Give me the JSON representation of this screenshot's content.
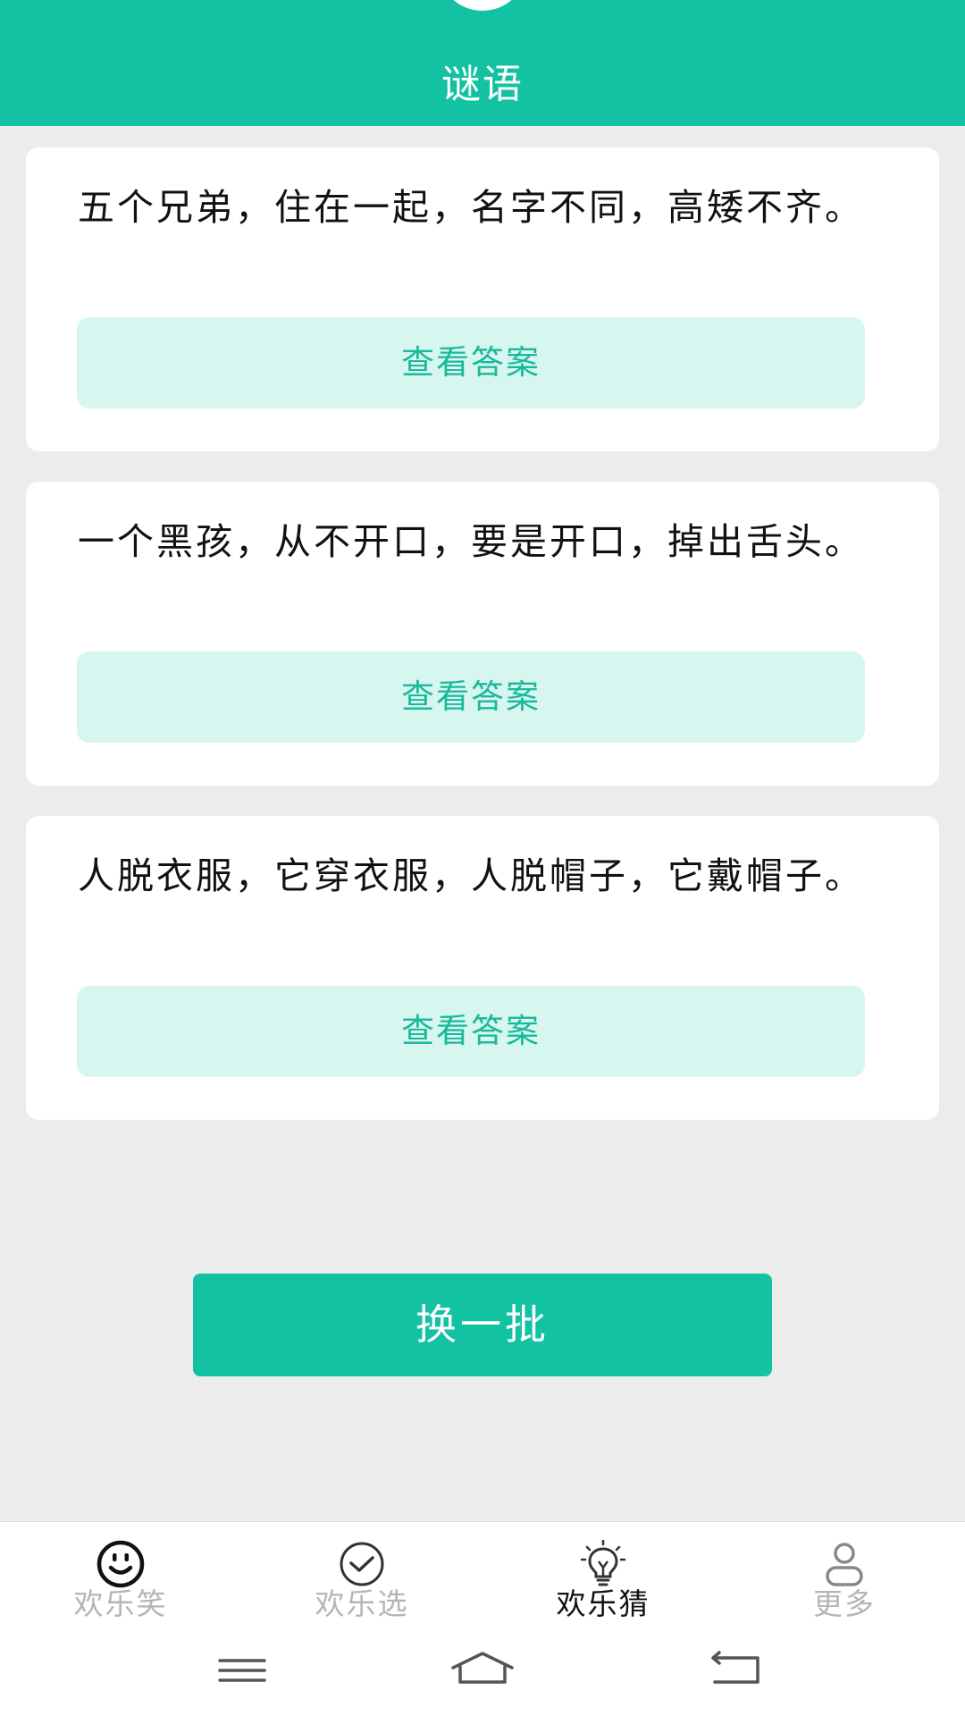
{
  "header": {
    "title": "谜语"
  },
  "riddles": [
    {
      "question": "五个兄弟，住在一起，名字不同，高矮不齐。",
      "answer_button": "查看答案"
    },
    {
      "question": "一个黑孩，从不开口，要是开口，掉出舌头。",
      "answer_button": "查看答案"
    },
    {
      "question": "人脱衣服，它穿衣服，人脱帽子，它戴帽子。",
      "answer_button": "查看答案"
    }
  ],
  "refresh_button": "换一批",
  "tabs": [
    {
      "label": "欢乐笑",
      "icon": "smiley-face-icon",
      "active": false
    },
    {
      "label": "欢乐选",
      "icon": "check-circle-icon",
      "active": false
    },
    {
      "label": "欢乐猜",
      "icon": "lightbulb-icon",
      "active": true
    },
    {
      "label": "更多",
      "icon": "person-icon",
      "active": false
    }
  ],
  "colors": {
    "primary": "#12c2a3",
    "answer_bg": "#d6f6ef",
    "answer_text": "#19b99c",
    "page_bg": "#ececec",
    "tab_inactive": "#b5b5b5",
    "tab_active": "#111111"
  },
  "system_nav": {
    "icons": [
      "menu-icon",
      "home-icon",
      "back-icon"
    ]
  }
}
